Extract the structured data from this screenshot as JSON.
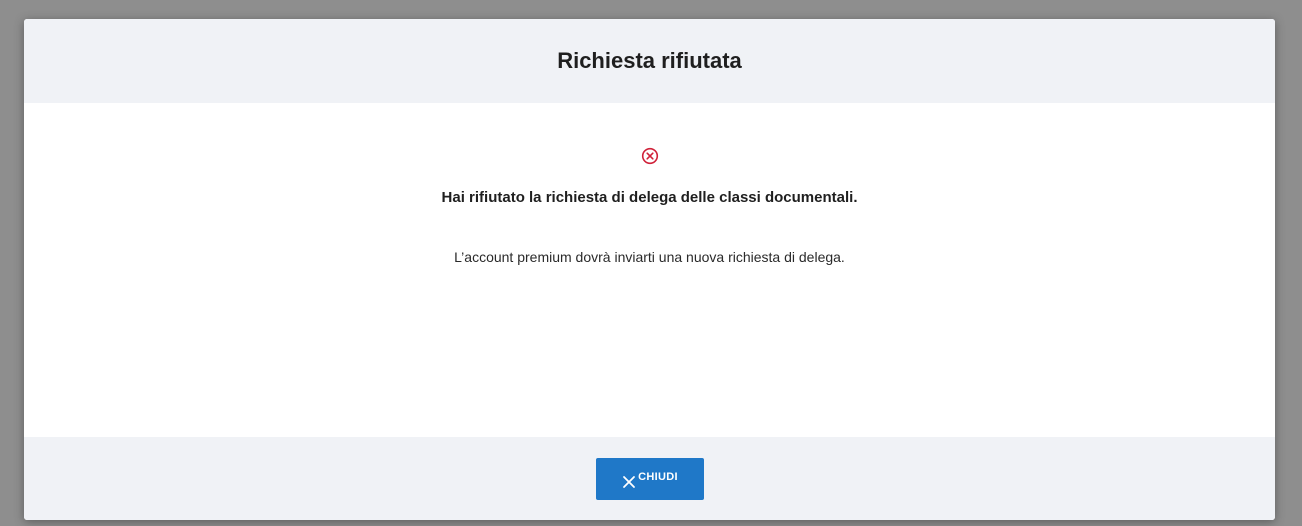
{
  "dialog": {
    "title": "Richiesta rifiutata",
    "status_icon": "error-circle-x-icon",
    "message": "Hai rifiutato la richiesta di delega delle classi documentali.",
    "submessage": "L’account premium dovrà inviarti una nuova richiesta di delega.",
    "close_button": {
      "label": "CHIUDI",
      "icon": "close-icon"
    }
  },
  "colors": {
    "overlay": "#8e8e8e",
    "header_footer_bg": "#f0f2f6",
    "button_bg": "#1f78c8",
    "error": "#d0223a"
  }
}
